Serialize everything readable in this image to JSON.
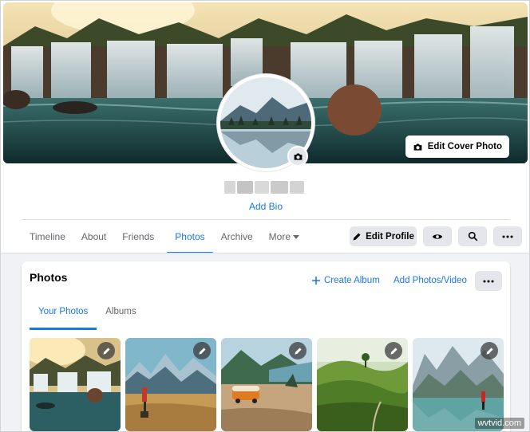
{
  "cover": {
    "edit_label": "Edit Cover Photo",
    "icon": "camera-icon"
  },
  "profile": {
    "avatar_icon": "camera-icon",
    "add_bio": "Add Bio"
  },
  "nav": {
    "tabs": [
      {
        "label": "Timeline",
        "active": false
      },
      {
        "label": "About",
        "active": false
      },
      {
        "label": "Friends",
        "active": false
      },
      {
        "label": "Photos",
        "active": true
      },
      {
        "label": "Archive",
        "active": false
      },
      {
        "label": "More",
        "active": false
      }
    ],
    "edit_profile": "Edit Profile",
    "view_icon": "eye-icon",
    "search_icon": "search-icon",
    "more_icon": "ellipsis-icon"
  },
  "photos": {
    "title": "Photos",
    "create_album": "Create Album",
    "add_photos": "Add Photos/Video",
    "subtabs": [
      {
        "label": "Your Photos",
        "active": true
      },
      {
        "label": "Albums",
        "active": false
      }
    ],
    "thumb_icon": "pencil-icon"
  },
  "watermark": "wvtvid.com",
  "colors": {
    "accent": "#1877f2",
    "button_bg": "#e4e6eb",
    "page_bg": "#f0f2f5"
  }
}
